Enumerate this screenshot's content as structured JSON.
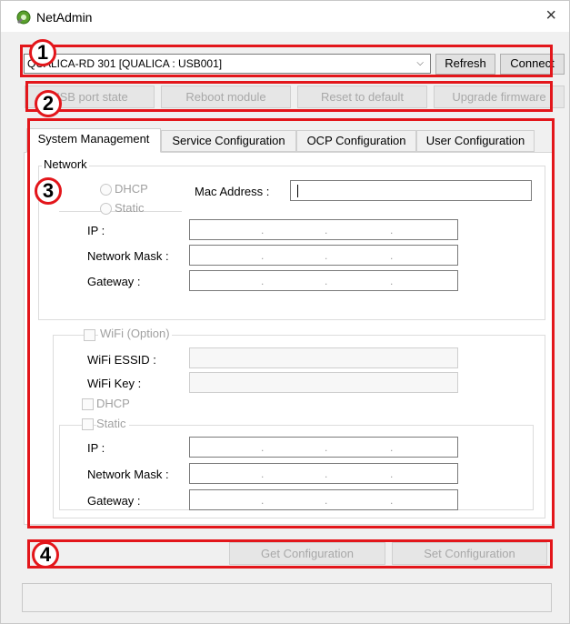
{
  "window": {
    "title": "NetAdmin",
    "close_glyph": "×",
    "icon": "netadmin-app-icon"
  },
  "device_bar": {
    "selected_device": "QUALICA-RD 301 [QUALICA : USB001]",
    "caret_glyph": "⌵",
    "refresh_label": "Refresh",
    "connect_label": "Connect"
  },
  "actions": {
    "usb_port_state": "USB port state",
    "reboot_module": "Reboot module",
    "reset_to_default": "Reset to default",
    "upgrade_firmware": "Upgrade firmware"
  },
  "tabs": [
    {
      "label": "System Management",
      "active": true
    },
    {
      "label": "Service Configuration"
    },
    {
      "label": "OCP Configuration"
    },
    {
      "label": "User Configuration"
    }
  ],
  "network": {
    "group_title": "Network",
    "dhcp_label": "DHCP",
    "static_label": "Static",
    "mac_label": "Mac Address :",
    "mac_value": "",
    "ip_label": "IP :",
    "mask_label": "Network Mask :",
    "gateway_label": "Gateway :"
  },
  "wifi": {
    "option_label": "WiFi (Option)",
    "essid_label": "WiFi ESSID :",
    "key_label": "WiFi Key :",
    "dhcp_label": "DHCP",
    "static_label": "Static",
    "ip_label": "IP :",
    "mask_label": "Network Mask :",
    "gateway_label": "Gateway :"
  },
  "footer": {
    "get_configuration": "Get Configuration",
    "set_configuration": "Set Configuration"
  },
  "badges": [
    "1",
    "2",
    "3",
    "4"
  ],
  "colors": {
    "annotation_red": "#e3161b",
    "disabled_text": "#a8a8a8"
  }
}
